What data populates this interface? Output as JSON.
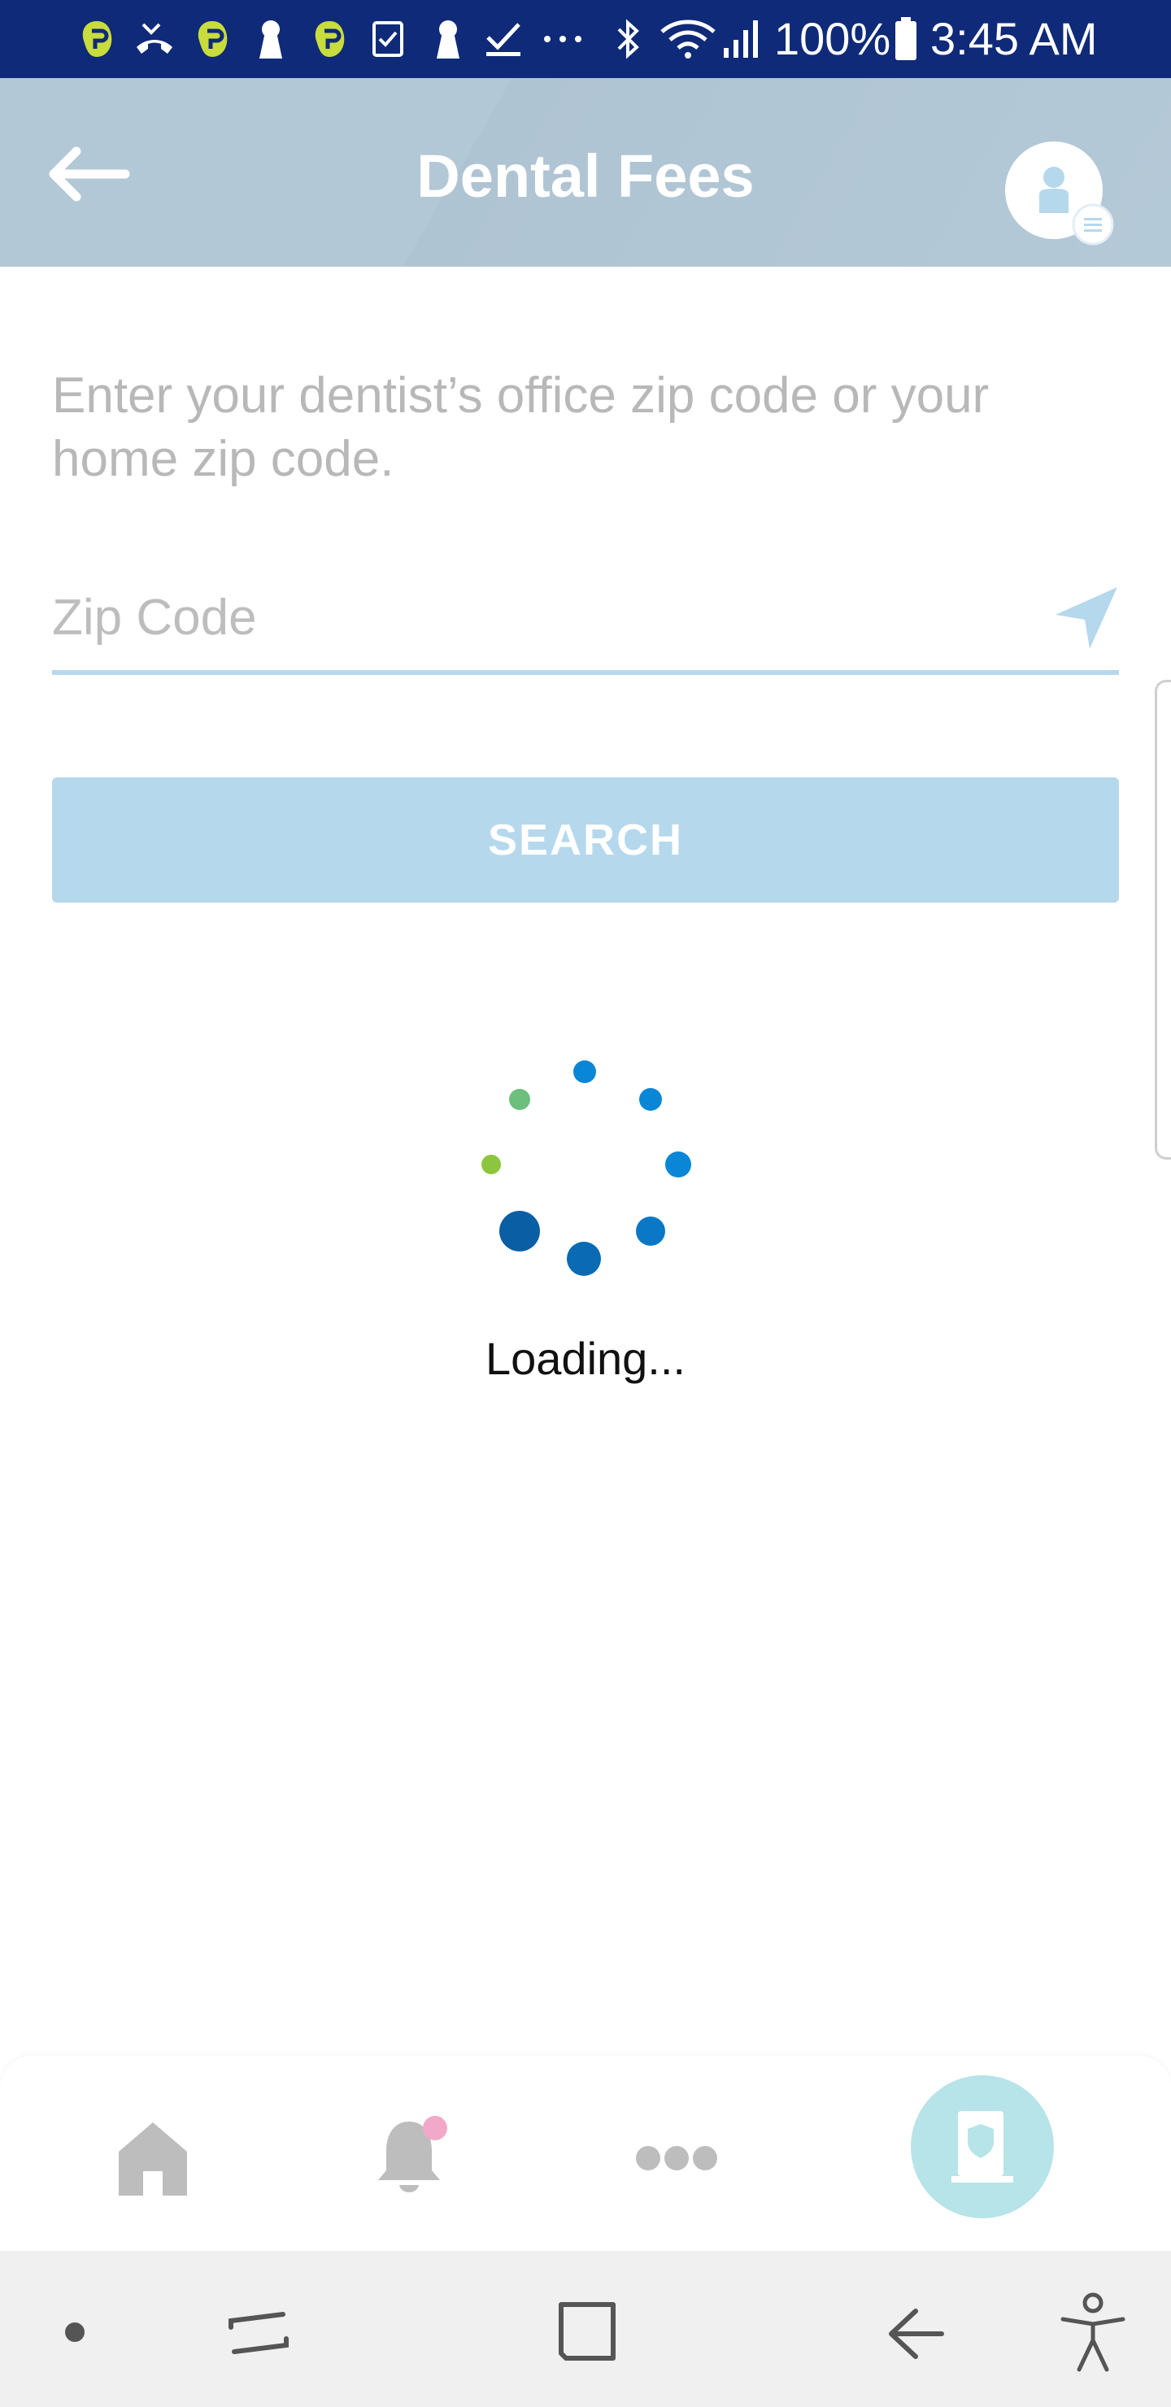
{
  "status_bar": {
    "battery": "100%",
    "time": "3:45 AM",
    "icons": [
      "app-notification-icon",
      "missed-call-icon",
      "app-notification-icon",
      "keyhole-icon",
      "app-notification-icon",
      "checklist-icon",
      "keyhole-icon",
      "checkmark-icon",
      "more-notifications-icon",
      "bluetooth-icon",
      "wifi-icon",
      "signal-icon",
      "battery-icon"
    ]
  },
  "header": {
    "title": "Dental Fees",
    "back_icon": "arrow-left-icon",
    "profile_icon": "profile-menu-icon"
  },
  "main": {
    "prompt": "Enter your dentist’s office zip code or your home zip code.",
    "zip_placeholder": "Zip Code",
    "zip_value": "",
    "locate_icon": "location-arrow-icon",
    "search_label": "SEARCH",
    "loading_text": "Loading..."
  },
  "bottom_nav": {
    "items": [
      {
        "icon": "home-icon"
      },
      {
        "icon": "bell-icon"
      },
      {
        "icon": "more-dots-icon"
      },
      {
        "icon": "insurance-card-icon"
      }
    ]
  },
  "colors": {
    "status_bar": "#0f2a78",
    "header": "#b3c8d6",
    "accent_light": "#b5d8ec",
    "spinner_blue": "#0a86d6",
    "spinner_green": "#6cbf7c",
    "notification_dot": "#f2a9c9",
    "fab": "#b6e4e8"
  }
}
